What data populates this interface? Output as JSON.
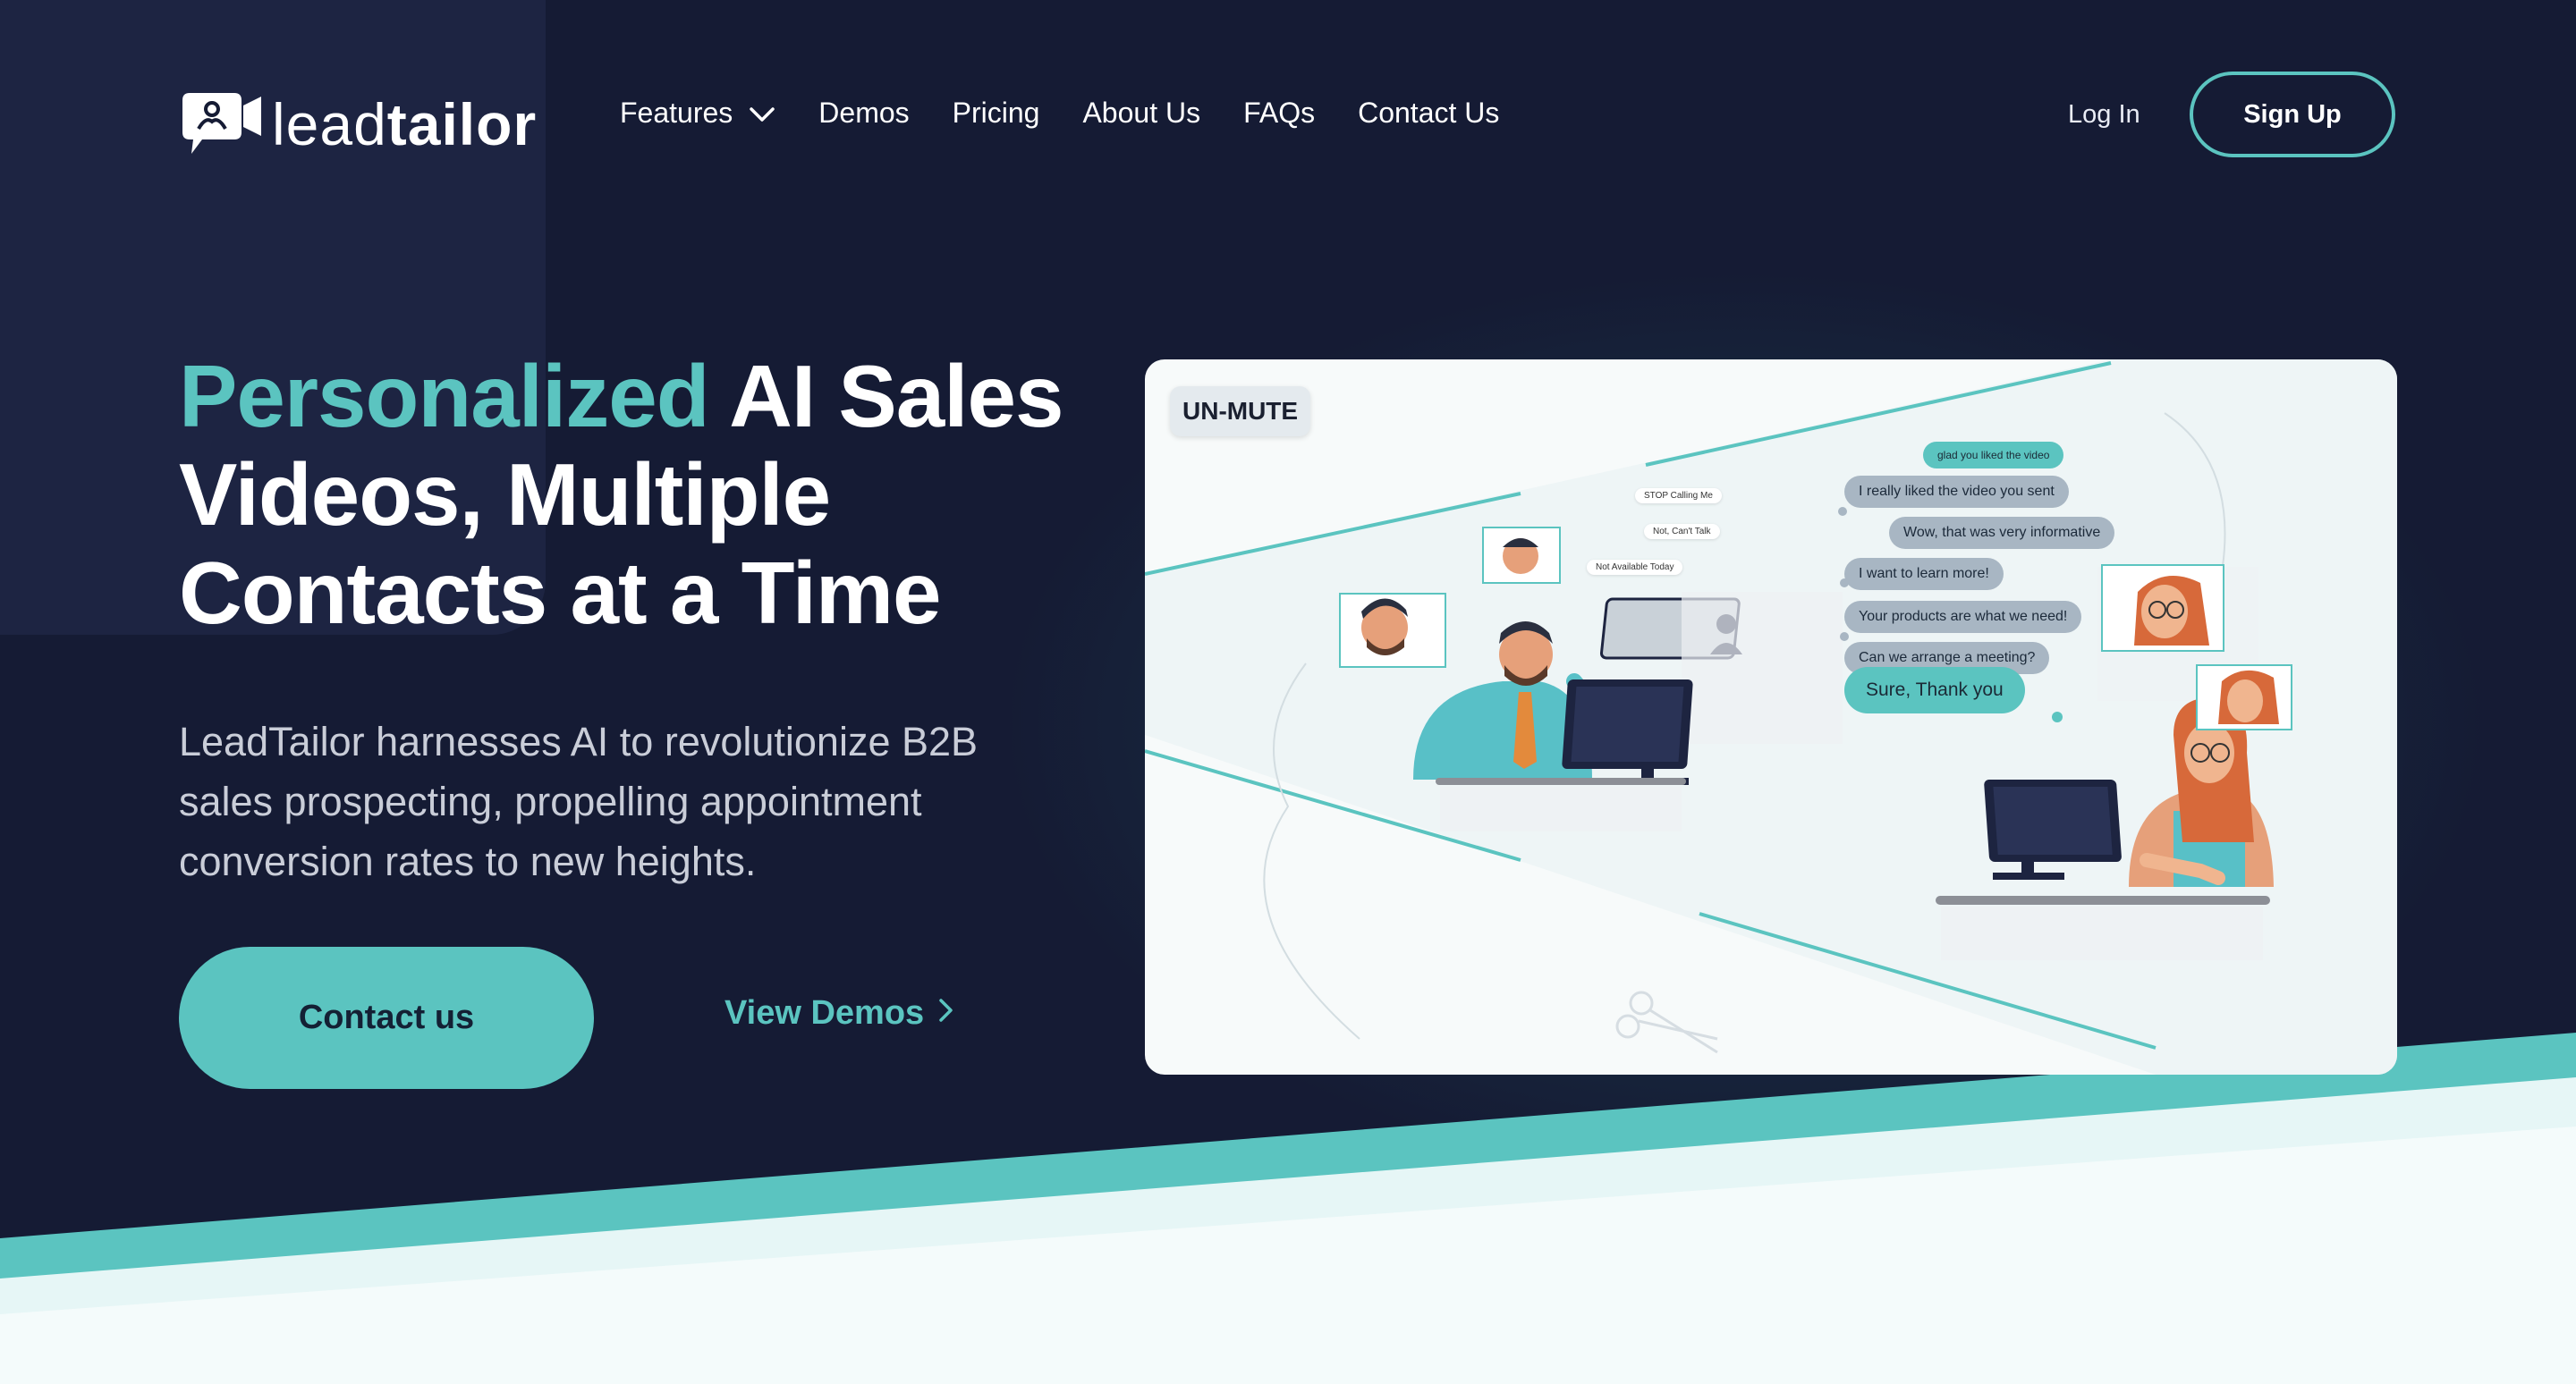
{
  "brand": {
    "logo_light": "lead",
    "logo_bold": "tailor",
    "accent_color": "#5bc4c0",
    "background_color": "#151b34"
  },
  "nav": {
    "items": [
      {
        "label": "Features",
        "icon": "chevron-down-icon"
      },
      {
        "label": "Demos"
      },
      {
        "label": "Pricing"
      },
      {
        "label": "About Us"
      },
      {
        "label": "FAQs"
      },
      {
        "label": "Contact Us"
      }
    ],
    "login": "Log In",
    "signup": "Sign Up"
  },
  "hero": {
    "title_highlight": "Personalized",
    "title_line1_rest": " AI Sales",
    "title_line2": "Videos, Multiple",
    "title_line3": "Contacts at a Time",
    "description": "LeadTailor harnesses AI to revolutionize B2B sales prospecting, propelling appointment conversion rates to new heights.",
    "cta_primary": "Contact us",
    "cta_secondary": "View Demos",
    "cta_secondary_icon": "chevron-right-icon"
  },
  "video": {
    "unmute_label": "UN-MUTE",
    "left_notes": [
      "STOP Calling Me",
      "Not, Can't Talk",
      "Not Available Today"
    ],
    "chat": [
      {
        "text": "glad you liked the video",
        "style": "teal"
      },
      {
        "text": "I really liked the video you sent",
        "style": "gray"
      },
      {
        "text": "Wow, that was very informative",
        "style": "gray"
      },
      {
        "text": "I want to learn more!",
        "style": "gray"
      },
      {
        "text": "Your products are what we need!",
        "style": "gray"
      },
      {
        "text": "Can we arrange a meeting?",
        "style": "gray"
      },
      {
        "text": "Sure, Thank you",
        "style": "teal"
      }
    ]
  }
}
